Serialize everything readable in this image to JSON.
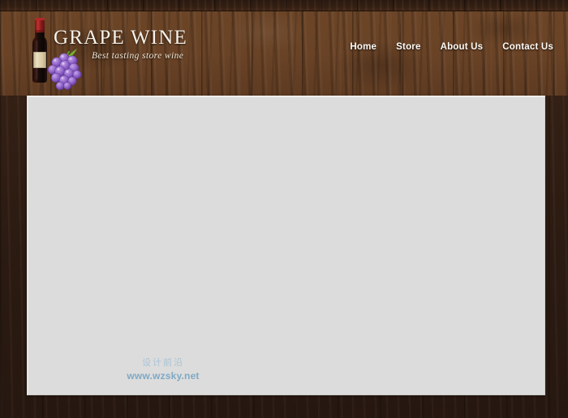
{
  "site": {
    "brand_title": "GRAPE WINE",
    "brand_tagline": "Best tasting store wine",
    "logo_bottle_icon": "wine-bottle-icon",
    "logo_grapes_icon": "grape-cluster-icon"
  },
  "nav": {
    "items": [
      {
        "label": "Home"
      },
      {
        "label": "Store"
      },
      {
        "label": "About Us"
      },
      {
        "label": "Contact Us"
      }
    ]
  },
  "content": {
    "watermark_cn": "设计前沿",
    "watermark_url": "www.wzsky.net"
  },
  "colors": {
    "wood_top_band": "#2e1c12",
    "wood_header": "#6c4527",
    "wood_body": "#2a1a12",
    "panel_bg": "#dcdcdc",
    "panel_border": "#efeeec",
    "brand_text": "#f6f1e8",
    "nav_text": "#fdfbf7",
    "watermark_cn": "#a8c3d4",
    "watermark_url": "#7fa9c4",
    "grape_purple": "#8a5fc0",
    "bottle_foil_red": "#9c2020",
    "bottle_label_cream": "#ded2ae"
  }
}
